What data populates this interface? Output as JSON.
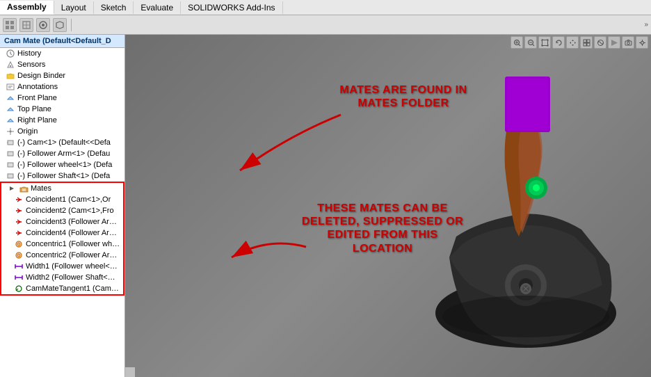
{
  "menubar": {
    "tabs": [
      "Assembly",
      "Layout",
      "Sketch",
      "Evaluate",
      "SOLIDWORKS Add-Ins"
    ],
    "active_tab": "Assembly"
  },
  "toolbar": {
    "icons": [
      "grid",
      "grid2",
      "cam",
      "img"
    ],
    "arrow_label": "»"
  },
  "feature_tree": {
    "header": "Cam Mate (Default<Default_D",
    "items": [
      {
        "id": "history",
        "label": "History",
        "icon": "clock",
        "indent": 1
      },
      {
        "id": "sensors",
        "label": "Sensors",
        "indent": 1
      },
      {
        "id": "design-binder",
        "label": "Design Binder",
        "indent": 1
      },
      {
        "id": "annotations",
        "label": "Annotations",
        "indent": 1
      },
      {
        "id": "front-plane",
        "label": "Front Plane",
        "indent": 1
      },
      {
        "id": "top-plane",
        "label": "Top Plane",
        "indent": 1
      },
      {
        "id": "right-plane",
        "label": "Right Plane",
        "indent": 1
      },
      {
        "id": "origin",
        "label": "Origin",
        "indent": 1
      },
      {
        "id": "cam",
        "label": "(-) Cam<1> (Default<<Defa",
        "indent": 1
      },
      {
        "id": "follower-arm",
        "label": "(-) Follower Arm<1> (Defau",
        "indent": 1
      },
      {
        "id": "follower-wheel",
        "label": "(-) Follower wheel<1> (Defa",
        "indent": 1
      },
      {
        "id": "follower-shaft",
        "label": "(-) Follower Shaft<1> (Defa",
        "indent": 1
      },
      {
        "id": "mates-folder",
        "label": "Mates",
        "indent": 1,
        "type": "folder"
      },
      {
        "id": "coincident1",
        "label": "Coincident1 (Cam<1>,Or",
        "indent": 2
      },
      {
        "id": "coincident2",
        "label": "Coincident2 (Cam<1>,Fro",
        "indent": 2
      },
      {
        "id": "coincident3",
        "label": "Coincident3 (Follower Ar…",
        "indent": 2
      },
      {
        "id": "coincident4",
        "label": "Coincident4 (Follower Ar…",
        "indent": 2
      },
      {
        "id": "concentric1",
        "label": "Concentric1 (Follower wh…",
        "indent": 2
      },
      {
        "id": "concentric2",
        "label": "Concentric2 (Follower Ar…",
        "indent": 2
      },
      {
        "id": "width1",
        "label": "Width1 (Follower wheel<…",
        "indent": 2
      },
      {
        "id": "width2",
        "label": "Width2 (Follower Shaft<…",
        "indent": 2
      },
      {
        "id": "cam-mate-tangent1",
        "label": "CamMateTangent1 (Cam…",
        "indent": 2
      }
    ]
  },
  "annotations": {
    "annotation1": {
      "line1": "MATES ARE FOUND IN",
      "line2": "MATES FOLDER"
    },
    "annotation2": {
      "line1": "THESE MATES CAN BE",
      "line2": "DELETED, SUPPRESSED OR",
      "line3": "EDITED FROM THIS",
      "line4": "LOCATION"
    }
  },
  "viewport_icons": [
    "zoom-in",
    "zoom-out",
    "zoom-fit",
    "rotate",
    "pan",
    "select",
    "appearance",
    "render",
    "camera",
    "settings"
  ]
}
